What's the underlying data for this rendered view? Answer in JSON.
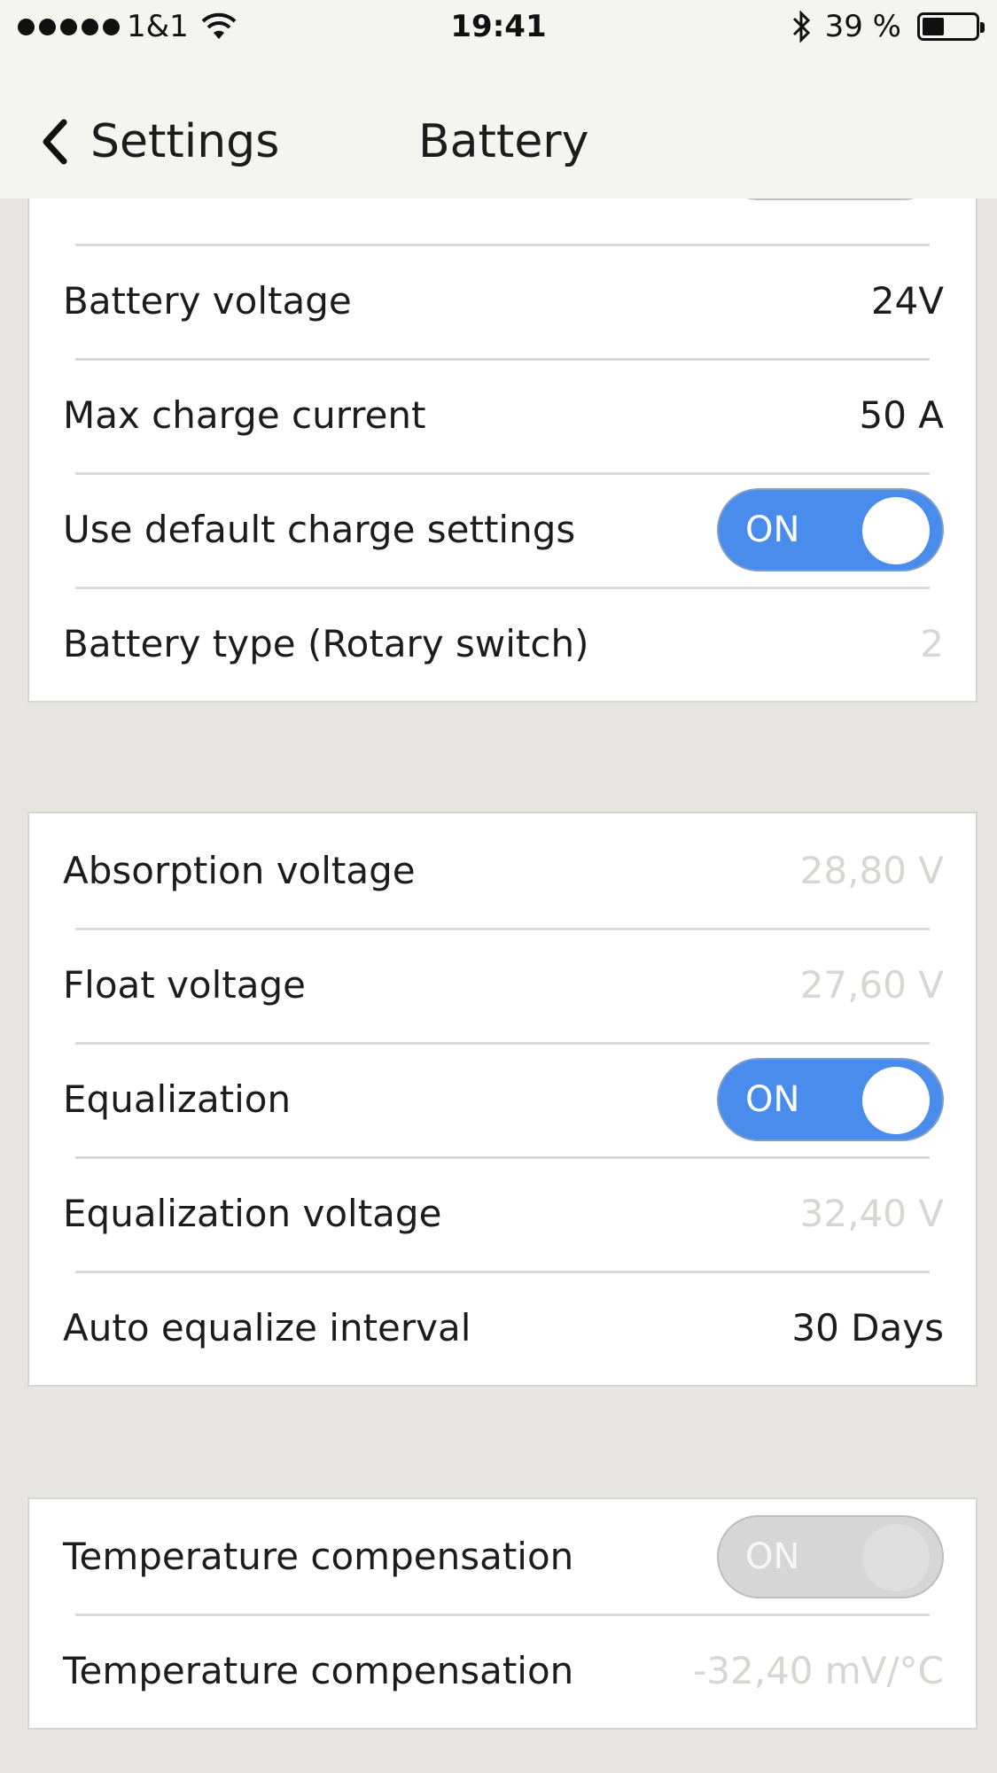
{
  "status_bar": {
    "carrier": "1&1",
    "time": "19:41",
    "battery_percent": "39 %",
    "battery_level": 0.39
  },
  "nav": {
    "back_label": "Settings",
    "title": "Battery"
  },
  "top_group": {
    "rows": [
      {
        "label": "Battery voltage",
        "value": "24V"
      },
      {
        "label": "Max charge current",
        "value": "50 A"
      },
      {
        "label": "Use default charge settings",
        "toggle": "ON"
      },
      {
        "label": "Battery type (Rotary switch)",
        "value": "2"
      }
    ]
  },
  "charge_group": {
    "rows": [
      {
        "label": "Absorption voltage",
        "value": "28,80 V"
      },
      {
        "label": "Float voltage",
        "value": "27,60 V"
      },
      {
        "label": "Equalization",
        "toggle": "ON"
      },
      {
        "label": "Equalization voltage",
        "value": "32,40 V"
      },
      {
        "label": "Auto equalize interval",
        "value": "30 Days"
      }
    ]
  },
  "temp_group": {
    "rows": [
      {
        "label": "Temperature compensation",
        "toggle": "ON"
      },
      {
        "label": "Temperature compensation",
        "value": "-32,40 mV/°C"
      }
    ]
  },
  "colors": {
    "toggle_on": "#4a8cec",
    "toggle_off_red": "#f57373",
    "toggle_disabled": "#d6d6d6",
    "muted_value": "#d6d6d3"
  }
}
